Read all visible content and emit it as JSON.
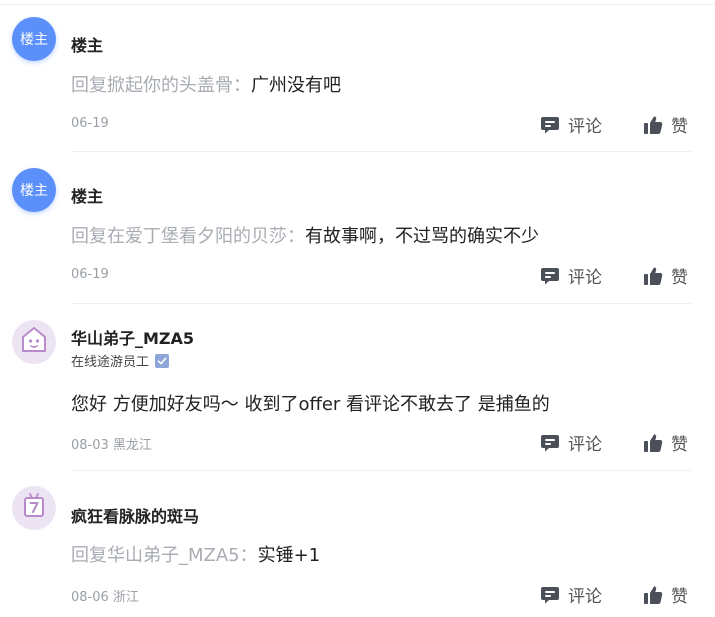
{
  "actions": {
    "comment_label": "评论",
    "like_label": "赞"
  },
  "comments": [
    {
      "avatar_text": "楼主",
      "username": "楼主",
      "reply_prefix": "回复掀起你的头盖骨：",
      "text": "广州没有吧",
      "meta": "06-19"
    },
    {
      "avatar_text": "楼主",
      "username": "楼主",
      "reply_prefix": "回复在爱丁堡看夕阳的贝莎：",
      "text": "有故事啊，不过骂的确实不少",
      "meta": "06-19"
    },
    {
      "avatar_icon": "house-mascot-icon",
      "username": "华山弟子_MZA5",
      "title": "在线途游员工",
      "text": "您好 方便加好友吗～ 收到了offer 看评论不敢去了 是捕鱼的",
      "meta": "08-03 黑龙江"
    },
    {
      "avatar_icon": "calendar-mascot-icon",
      "username": "疯狂看脉脉的斑马",
      "reply_prefix": "回复华山弟子_MZA5：",
      "text": "实锤+1",
      "meta": "08-06 浙江"
    }
  ]
}
